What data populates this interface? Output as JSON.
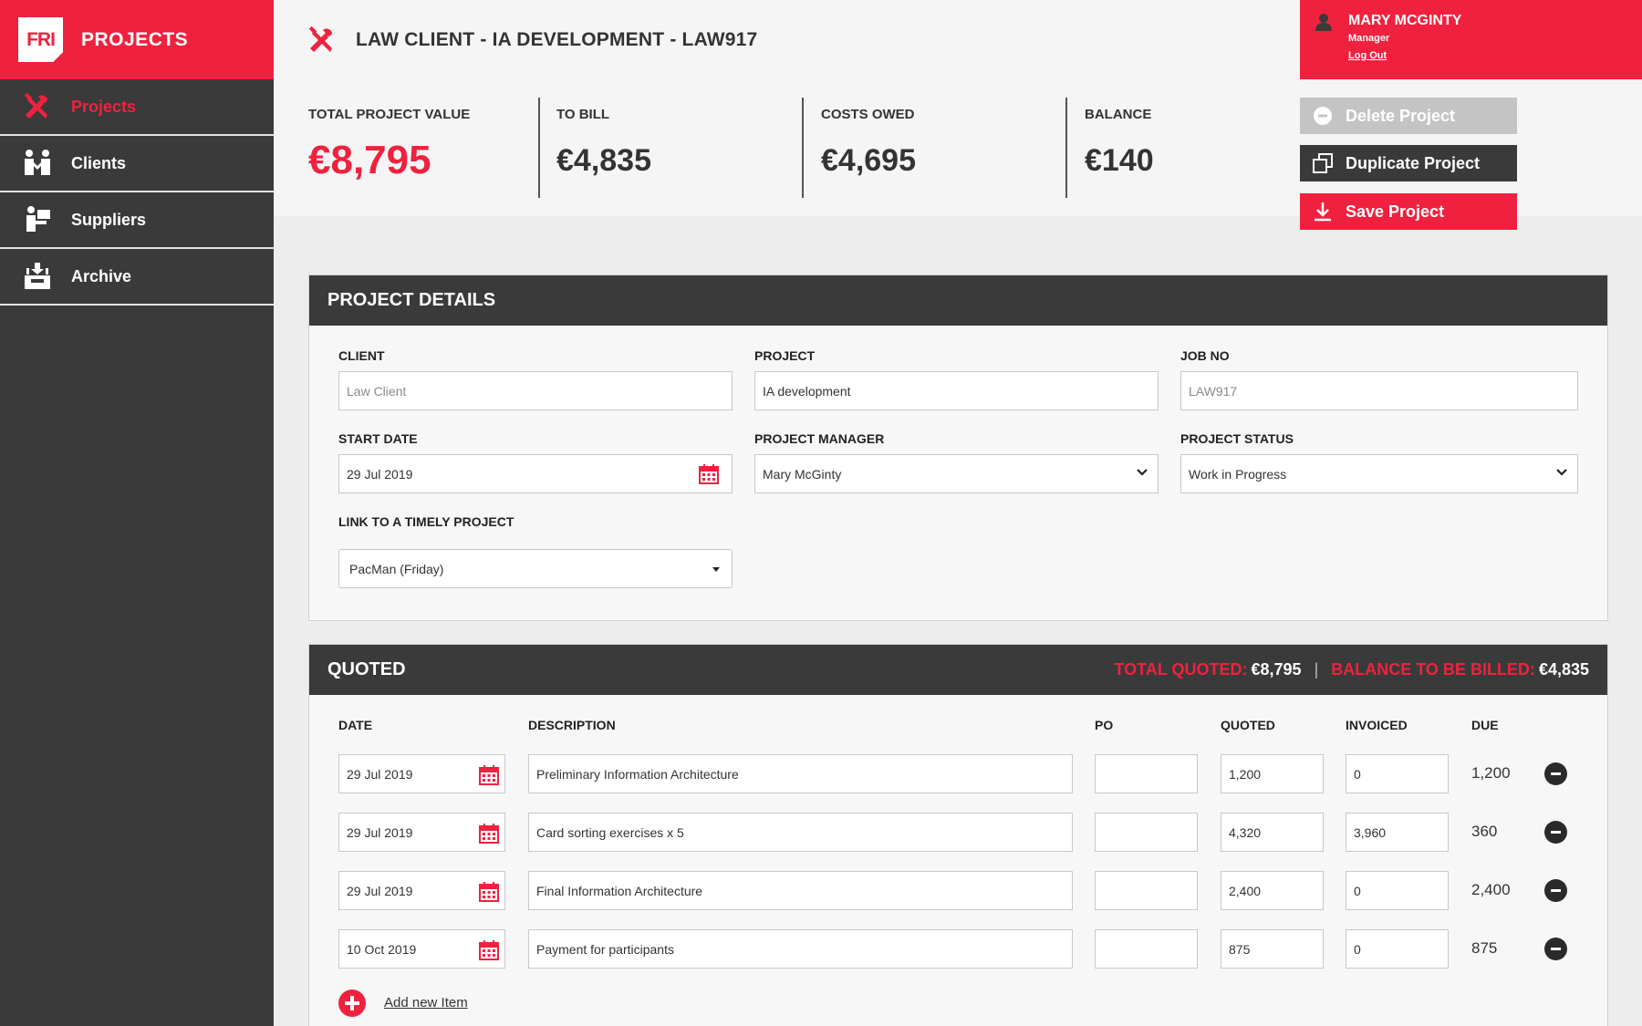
{
  "brand": {
    "logo_text": "FRI",
    "title": "PROJECTS"
  },
  "sidebar": {
    "items": [
      {
        "label": "Projects",
        "icon": "tools-icon",
        "active": true
      },
      {
        "label": "Clients",
        "icon": "clients-icon",
        "active": false
      },
      {
        "label": "Suppliers",
        "icon": "suppliers-icon",
        "active": false
      },
      {
        "label": "Archive",
        "icon": "archive-icon",
        "active": false
      }
    ]
  },
  "header": {
    "title": "LAW CLIENT - IA DEVELOPMENT - LAW917"
  },
  "user": {
    "name": "MARY MCGINTY",
    "role": "Manager",
    "logout": "Log Out"
  },
  "summary": {
    "total_label": "TOTAL PROJECT VALUE",
    "total_value": "€8,795",
    "tobill_label": "TO BILL",
    "tobill_value": "€4,835",
    "costs_label": "COSTS OWED",
    "costs_value": "€4,695",
    "balance_label": "BALANCE",
    "balance_value": "€140"
  },
  "actions": {
    "delete": "Delete Project",
    "duplicate": "Duplicate Project",
    "save": "Save Project"
  },
  "details": {
    "title": "PROJECT DETAILS",
    "client_label": "CLIENT",
    "client_placeholder": "Law Client",
    "project_label": "PROJECT",
    "project_value": "IA development",
    "jobno_label": "JOB NO",
    "jobno_placeholder": "LAW917",
    "start_label": "START DATE",
    "start_value": "29 Jul 2019",
    "manager_label": "PROJECT MANAGER",
    "manager_value": "Mary McGinty",
    "status_label": "PROJECT STATUS",
    "status_value": "Work in Progress",
    "timely_label": "LINK TO A TIMELY PROJECT",
    "timely_value": "PacMan (Friday)"
  },
  "quoted": {
    "title": "QUOTED",
    "total_label": "TOTAL QUOTED:",
    "total_value": "€8,795",
    "balance_label": "BALANCE TO BE BILLED:",
    "balance_value": "€4,835",
    "columns": {
      "date": "DATE",
      "description": "DESCRIPTION",
      "po": "PO",
      "quoted": "QUOTED",
      "invoiced": "INVOICED",
      "due": "DUE"
    },
    "rows": [
      {
        "date": "29 Jul 2019",
        "description": "Preliminary Information Architecture",
        "po": "",
        "quoted": "1,200",
        "invoiced": "0",
        "due": "1,200"
      },
      {
        "date": "29 Jul 2019",
        "description": "Card sorting exercises x 5",
        "po": "",
        "quoted": "4,320",
        "invoiced": "3,960",
        "due": "360"
      },
      {
        "date": "29 Jul 2019",
        "description": "Final Information Architecture",
        "po": "",
        "quoted": "2,400",
        "invoiced": "0",
        "due": "2,400"
      },
      {
        "date": "10 Oct 2019",
        "description": "Payment for participants",
        "po": "",
        "quoted": "875",
        "invoiced": "0",
        "due": "875"
      }
    ],
    "add_label": "Add new Item"
  },
  "colors": {
    "accent": "#f0213f",
    "dark": "#3a3a3a",
    "muted_button": "#c4c4c4"
  }
}
